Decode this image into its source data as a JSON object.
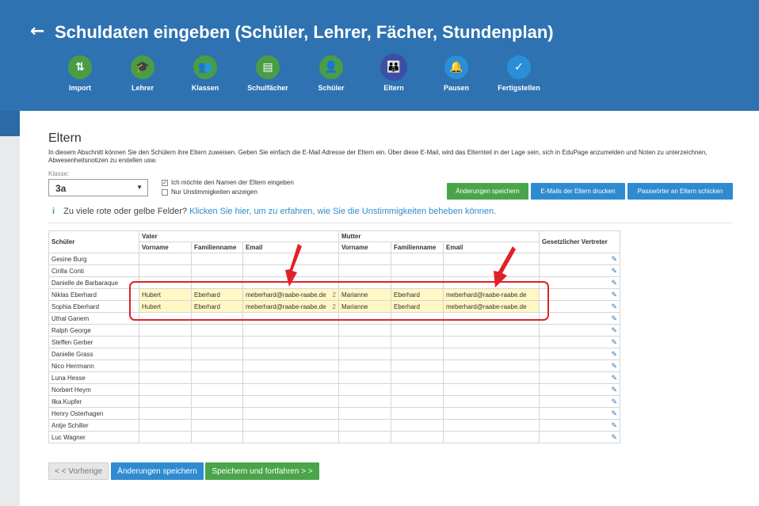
{
  "header": {
    "title": "Schuldaten eingeben (Schüler, Lehrer, Fächer, Stundenplan)",
    "steps": [
      {
        "label": "Import",
        "icon": "import-icon",
        "glyph": "⇅",
        "style": "green"
      },
      {
        "label": "Lehrer",
        "icon": "graduation-cap-icon",
        "glyph": "🎓",
        "style": "green"
      },
      {
        "label": "Klassen",
        "icon": "group-icon",
        "glyph": "👥",
        "style": "green"
      },
      {
        "label": "Schulfächer",
        "icon": "book-icon",
        "glyph": "▤",
        "style": "green"
      },
      {
        "label": "Schüler",
        "icon": "user-icon",
        "glyph": "👤",
        "style": "green"
      },
      {
        "label": "Eltern",
        "icon": "parents-icon",
        "glyph": "👪",
        "style": "active"
      },
      {
        "label": "Pausen",
        "icon": "bell-icon",
        "glyph": "🔔",
        "style": "blue"
      },
      {
        "label": "Fertigstellen",
        "icon": "checkmark-icon",
        "glyph": "✓",
        "style": "blue"
      }
    ]
  },
  "section": {
    "title": "Eltern",
    "description": "In diesem Abschnitt können Sie den Schülern ihre Eltern zuweisen. Geben Sie einfach die E-Mail Adresse der Eltern ein. Über diese E-Mail, wird das Elternteil in der Lage sein, sich in EduPage anzumelden und Noten zu unterzeichnen, Abwesenheitsnotizen zu erstellen usw."
  },
  "class_select": {
    "label": "Klasse:",
    "value": "3a"
  },
  "checkboxes": [
    {
      "label": "Ich möchte den Namen der Eltern eingeben",
      "checked": "✓"
    },
    {
      "label": "Nur Unstimmigkeiten anzeigen",
      "checked": ""
    }
  ],
  "actions": {
    "save": "Änderungen speichern",
    "print_emails": "E-Mails der Eltern drucken",
    "send_passwords": "Passwörter an Eltern schicken"
  },
  "info": {
    "text": "Zu viele rote oder gelbe Felder?",
    "link": "Klicken Sie hier, um zu erfahren, wie Sie die Unstimmigkeiten beheben können."
  },
  "table": {
    "headers": {
      "student": "Schüler",
      "father": "Vater",
      "mother": "Mutter",
      "first_name": "Vorname",
      "last_name": "Familienname",
      "email": "Email",
      "guardian": "Gesetzlicher Vertreter"
    },
    "rows": [
      {
        "student": "Gesine Burg",
        "father_first": "",
        "father_last": "",
        "father_email": "",
        "father_count": "",
        "mother_first": "",
        "mother_last": "",
        "mother_email": ""
      },
      {
        "student": "Cirilla Conti",
        "father_first": "",
        "father_last": "",
        "father_email": "",
        "father_count": "",
        "mother_first": "",
        "mother_last": "",
        "mother_email": ""
      },
      {
        "student": "Danielle de Barbaraque",
        "father_first": "",
        "father_last": "",
        "father_email": "",
        "father_count": "",
        "mother_first": "",
        "mother_last": "",
        "mother_email": ""
      },
      {
        "student": "Niklas Eberhard",
        "father_first": "Hubert",
        "father_last": "Eberhard",
        "father_email": "meberhard@raabe-raabe.de",
        "father_count": "2",
        "mother_first": "Marianne",
        "mother_last": "Eberhard",
        "mother_email": "meberhard@raabe-raabe.de",
        "highlight": true
      },
      {
        "student": "Sophia Eberhard",
        "father_first": "Hubert",
        "father_last": "Eberhard",
        "father_email": "meberhard@raabe-raabe.de",
        "father_count": "2",
        "mother_first": "Marianne",
        "mother_last": "Eberhard",
        "mother_email": "meberhard@raabe-raabe.de",
        "highlight": true
      },
      {
        "student": "Uthal Ganem",
        "father_first": "",
        "father_last": "",
        "father_email": "",
        "father_count": "",
        "mother_first": "",
        "mother_last": "",
        "mother_email": ""
      },
      {
        "student": "Ralph George",
        "father_first": "",
        "father_last": "",
        "father_email": "",
        "father_count": "",
        "mother_first": "",
        "mother_last": "",
        "mother_email": ""
      },
      {
        "student": "Steffen Gerber",
        "father_first": "",
        "father_last": "",
        "father_email": "",
        "father_count": "",
        "mother_first": "",
        "mother_last": "",
        "mother_email": ""
      },
      {
        "student": "Danielle Grass",
        "father_first": "",
        "father_last": "",
        "father_email": "",
        "father_count": "",
        "mother_first": "",
        "mother_last": "",
        "mother_email": ""
      },
      {
        "student": "Nico Herrmann",
        "father_first": "",
        "father_last": "",
        "father_email": "",
        "father_count": "",
        "mother_first": "",
        "mother_last": "",
        "mother_email": ""
      },
      {
        "student": "Luna Hesse",
        "father_first": "",
        "father_last": "",
        "father_email": "",
        "father_count": "",
        "mother_first": "",
        "mother_last": "",
        "mother_email": ""
      },
      {
        "student": "Norbert Heym",
        "father_first": "",
        "father_last": "",
        "father_email": "",
        "father_count": "",
        "mother_first": "",
        "mother_last": "",
        "mother_email": ""
      },
      {
        "student": "Ilka Kupfer",
        "father_first": "",
        "father_last": "",
        "father_email": "",
        "father_count": "",
        "mother_first": "",
        "mother_last": "",
        "mother_email": ""
      },
      {
        "student": "Henry Osterhagen",
        "father_first": "",
        "father_last": "",
        "father_email": "",
        "father_count": "",
        "mother_first": "",
        "mother_last": "",
        "mother_email": ""
      },
      {
        "student": "Antje Schiller",
        "father_first": "",
        "father_last": "",
        "father_email": "",
        "father_count": "",
        "mother_first": "",
        "mother_last": "",
        "mother_email": ""
      },
      {
        "student": "Luc Wagner",
        "father_first": "",
        "father_last": "",
        "father_email": "",
        "father_count": "",
        "mother_first": "",
        "mother_last": "",
        "mother_email": ""
      }
    ],
    "edit_glyph": "✎"
  },
  "footer": {
    "prev": "< < Vorherige",
    "save": "Änderungen speichern",
    "save_continue": "Speichern und fortfahren > >"
  },
  "colors": {
    "header": "#2e72b1",
    "green": "#4aa54a",
    "blue": "#2e8bd0",
    "highlight": "#fff7c4",
    "annotation": "#e0212a"
  }
}
